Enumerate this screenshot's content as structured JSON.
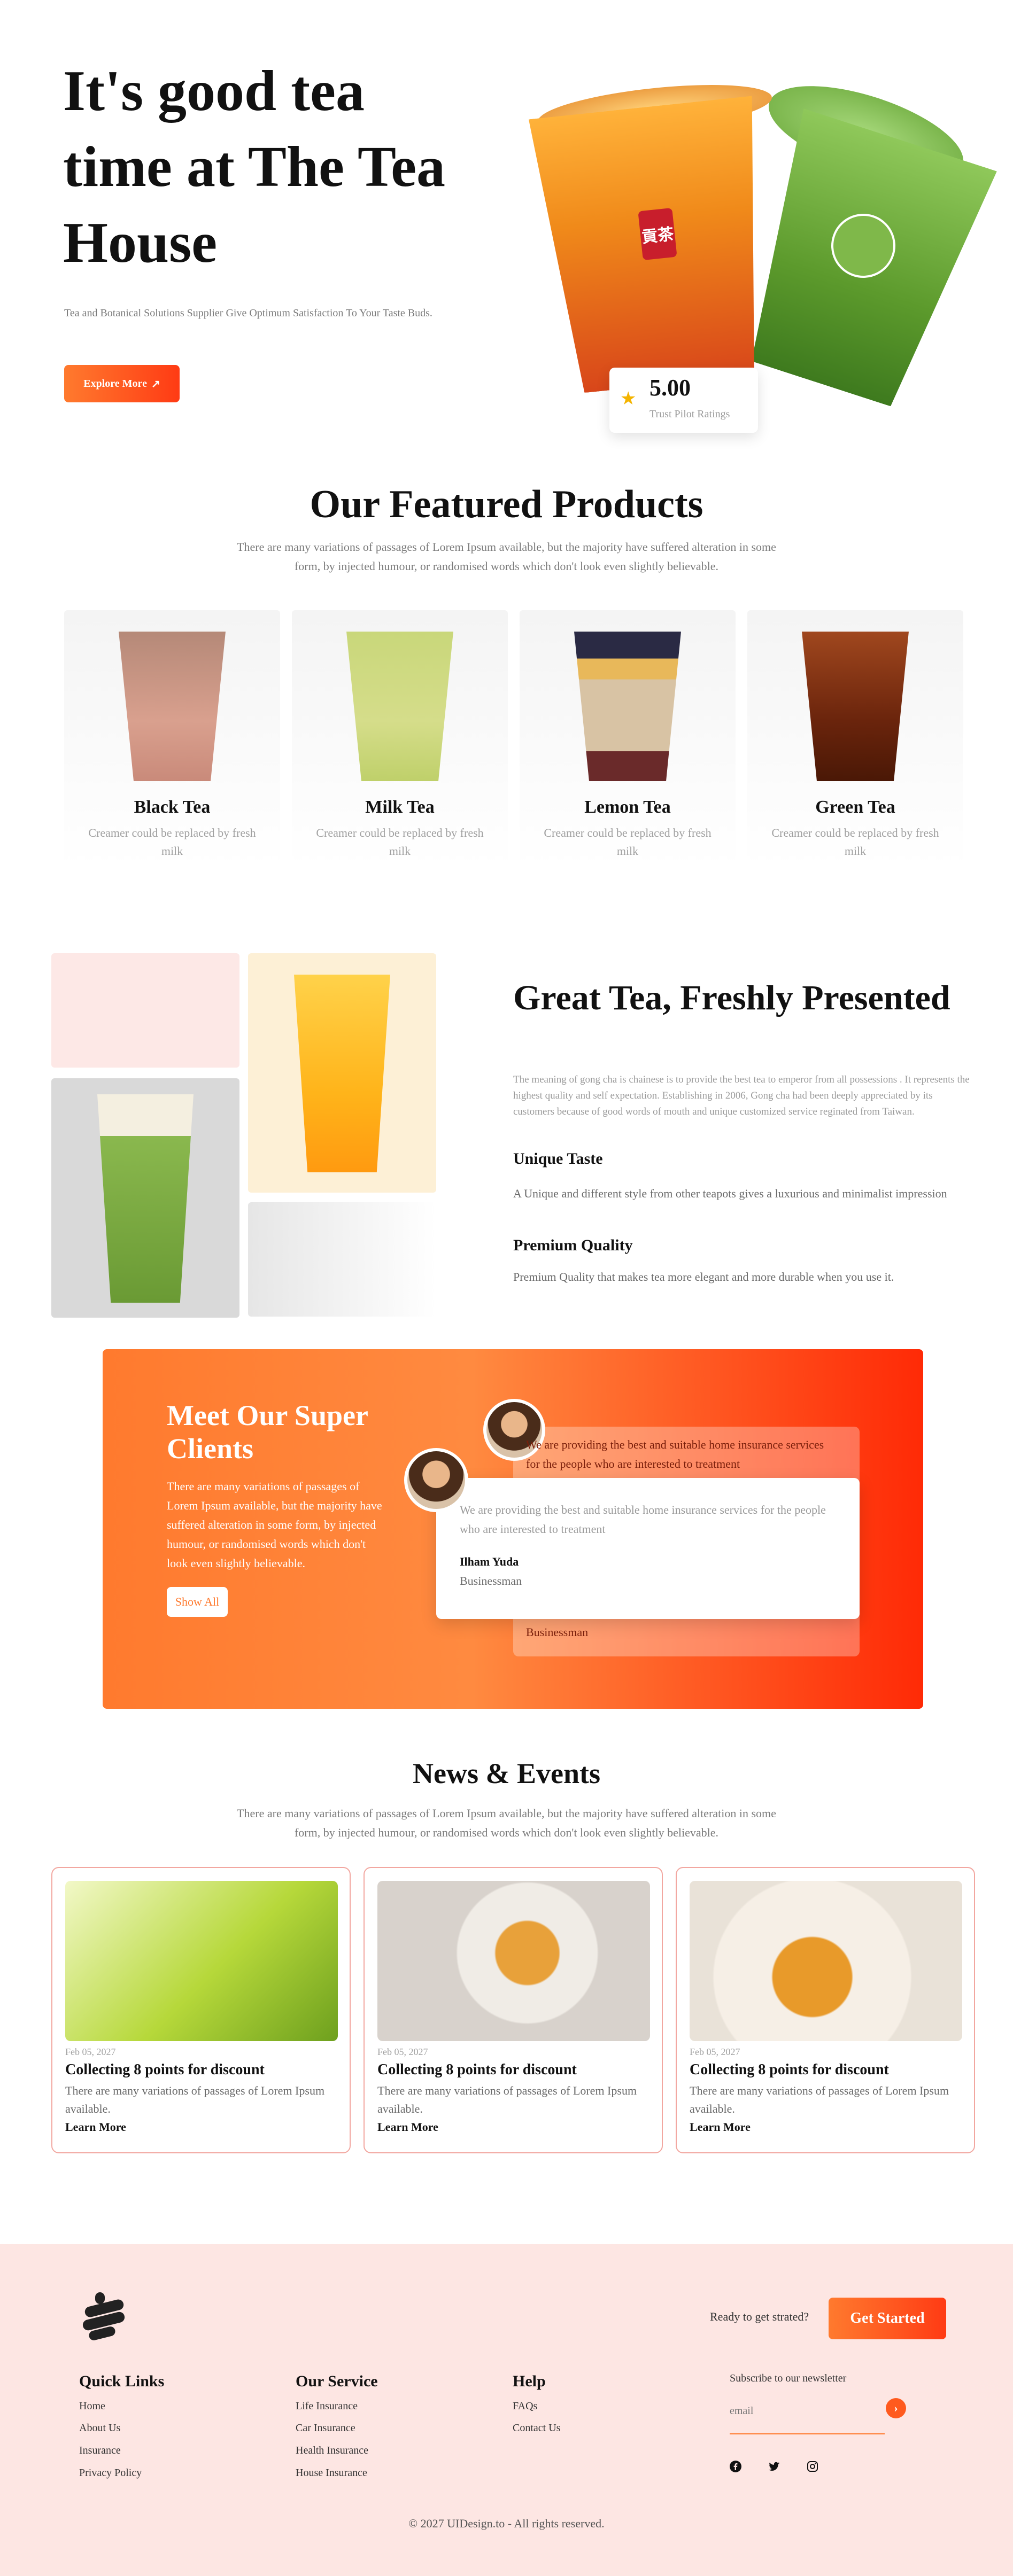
{
  "hero": {
    "title": "It's good tea time at The Tea House",
    "subtitle": "Tea and Botanical Solutions Supplier Give Optimum Satisfaction To Your Taste Buds.",
    "cta": "Explore More",
    "rating_value": "5.00",
    "rating_label": "Trust Pilot Ratings"
  },
  "featured": {
    "title": "Our Featured Products",
    "description": "There are many variations of passages of Lorem Ipsum available, but the majority have suffered alteration in some form, by injected humour, or randomised words which don't look even slightly believable.",
    "products": [
      {
        "name": "Black Tea",
        "desc": "Creamer could be replaced by fresh milk"
      },
      {
        "name": "Milk Tea",
        "desc": "Creamer could be replaced by fresh milk"
      },
      {
        "name": "Lemon Tea",
        "desc": "Creamer could be replaced by fresh milk"
      },
      {
        "name": "Green Tea",
        "desc": "Creamer could be replaced by fresh milk"
      }
    ]
  },
  "great": {
    "title": "Great Tea, Freshly Presented",
    "paragraph": "The meaning of gong cha is chainese is to provide the best tea to emperor from all possessions . It represents the highest quality and self expectation. Establishing in 2006, Gong cha had been deeply appreciated by its customers because of good words of mouth and unique customized service reginated from Taiwan.",
    "h1": "Unique Taste",
    "p1": "A Unique and different style from other teapots gives a luxurious and minimalist impression",
    "h2": "Premium Quality",
    "p2": "Premium Quality that makes tea more elegant and more durable when you use it."
  },
  "clients": {
    "title": "Meet Our Super Clients",
    "description": "There are many variations of passages of Lorem Ipsum available, but the majority have suffered alteration in some form, by injected humour, or randomised words which don't look even slightly believable.",
    "button": "Show All",
    "back_quote": "We are providing the best and suitable home insurance services for the people who are interested to treatment",
    "back_role": "Businessman",
    "front_quote": "We are providing the best and suitable home insurance services for the people who are interested to treatment",
    "front_name": "Ilham Yuda",
    "front_role": "Businessman"
  },
  "news": {
    "title": "News & Events",
    "description": "There are many variations of passages of Lorem Ipsum available, but the majority have suffered alteration in some form, by injected humour, or randomised words which don't look even slightly believable.",
    "items": [
      {
        "date": "Feb 05, 2027",
        "title": "Collecting 8 points for discount",
        "text": "There are many variations of passages of Lorem Ipsum available.",
        "link": "Learn More"
      },
      {
        "date": "Feb 05, 2027",
        "title": "Collecting 8 points for discount",
        "text": "There are many variations of passages of Lorem Ipsum available.",
        "link": "Learn More"
      },
      {
        "date": "Feb 05, 2027",
        "title": "Collecting 8 points for discount",
        "text": "There are many variations of passages of Lorem Ipsum available.",
        "link": "Learn More"
      }
    ]
  },
  "footer": {
    "ready": "Ready to get strated?",
    "get_started": "Get Started",
    "quick_links": {
      "title": "Quick Links",
      "items": [
        "Home",
        "About Us",
        "Insurance",
        "Privacy Policy"
      ]
    },
    "service": {
      "title": "Our Service",
      "items": [
        "Life Insurance",
        "Car Insurance",
        "Health Insurance",
        "House Insurance"
      ]
    },
    "help": {
      "title": "Help",
      "items": [
        "FAQs",
        "Contact Us"
      ]
    },
    "newsletter": "Subscribe to our newsletter",
    "email_placeholder": "email",
    "copyright": "© 2027 UIDesign.to - All rights reserved."
  },
  "colors": {
    "accent": "#ff5a1e",
    "footer_bg": "#fde6e3",
    "card_border": "#f2a7a0"
  }
}
